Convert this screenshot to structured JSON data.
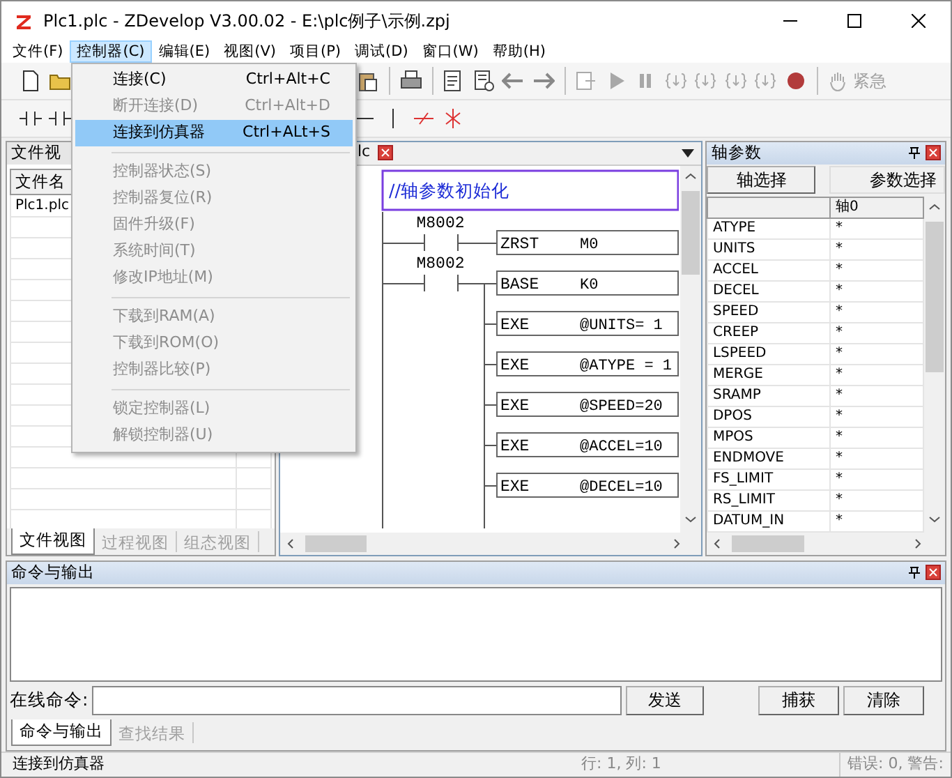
{
  "window": {
    "title": "Plc1.plc - ZDevelop V3.00.02 - E:\\plc例子\\示例.zpj"
  },
  "menu_bar": [
    {
      "label": "文件(F)",
      "selected": false
    },
    {
      "label": "控制器(C)",
      "selected": true
    },
    {
      "label": "编辑(E)",
      "selected": false
    },
    {
      "label": "视图(V)",
      "selected": false
    },
    {
      "label": "项目(P)",
      "selected": false
    },
    {
      "label": "调试(D)",
      "selected": false
    },
    {
      "label": "窗口(W)",
      "selected": false
    },
    {
      "label": "帮助(H)",
      "selected": false
    }
  ],
  "controller_menu": [
    {
      "kind": "item",
      "label": "连接(C)",
      "shortcut": "Ctrl+Alt+C",
      "disabled": false,
      "selected": false
    },
    {
      "kind": "item",
      "label": "断开连接(D)",
      "shortcut": "Ctrl+Alt+D",
      "disabled": true,
      "selected": false
    },
    {
      "kind": "item",
      "label": "连接到仿真器",
      "shortcut": "Ctrl+ALt+S",
      "disabled": false,
      "selected": true
    },
    {
      "kind": "separator"
    },
    {
      "kind": "item",
      "label": "控制器状态(S)",
      "disabled": true,
      "selected": false
    },
    {
      "kind": "item",
      "label": "控制器复位(R)",
      "disabled": true,
      "selected": false
    },
    {
      "kind": "item",
      "label": "固件升级(F)",
      "disabled": true,
      "selected": false
    },
    {
      "kind": "item",
      "label": "系统时间(T)",
      "disabled": true,
      "selected": false
    },
    {
      "kind": "item",
      "label": "修改IP地址(M)",
      "disabled": true,
      "selected": false
    },
    {
      "kind": "separator"
    },
    {
      "kind": "item",
      "label": "下载到RAM(A)",
      "disabled": true,
      "selected": false
    },
    {
      "kind": "item",
      "label": "下载到ROM(O)",
      "disabled": true,
      "selected": false
    },
    {
      "kind": "item",
      "label": "控制器比较(P)",
      "disabled": true,
      "selected": false
    },
    {
      "kind": "separator"
    },
    {
      "kind": "item",
      "label": "锁定控制器(L)",
      "disabled": true,
      "selected": false
    },
    {
      "kind": "item",
      "label": "解锁控制器(U)",
      "disabled": true,
      "selected": false
    }
  ],
  "toolbar": {
    "emergency_label": "紧急"
  },
  "file_panel": {
    "title": "文件视",
    "column": "文件名",
    "files": [
      "Plc1.plc"
    ],
    "tabs": [
      {
        "label": "文件视图",
        "selected": true
      },
      {
        "label": "过程视图",
        "selected": false
      },
      {
        "label": "组态视图",
        "selected": false
      }
    ]
  },
  "editor": {
    "tab": "lc",
    "comment": "//轴参数初始化",
    "rungs": [
      {
        "contact": "M8002",
        "instructions": [
          {
            "op": "ZRST",
            "arg": "M0"
          }
        ]
      },
      {
        "contact": "M8002",
        "instructions": [
          {
            "op": "BASE",
            "arg": "K0"
          },
          {
            "op": "EXE",
            "arg": "@UNITS= 1"
          },
          {
            "op": "EXE",
            "arg": "@ATYPE = 1"
          },
          {
            "op": "EXE",
            "arg": "@SPEED=20"
          },
          {
            "op": "EXE",
            "arg": "@ACCEL=10"
          },
          {
            "op": "EXE",
            "arg": "@DECEL=10"
          }
        ]
      }
    ]
  },
  "axis_panel": {
    "title": "轴参数",
    "buttons": [
      "轴选择",
      "参数选择"
    ],
    "column": "轴0",
    "rows": [
      {
        "name": "ATYPE",
        "value": "*"
      },
      {
        "name": "UNITS",
        "value": "*"
      },
      {
        "name": "ACCEL",
        "value": "*"
      },
      {
        "name": "DECEL",
        "value": "*"
      },
      {
        "name": "SPEED",
        "value": "*"
      },
      {
        "name": "CREEP",
        "value": "*"
      },
      {
        "name": "LSPEED",
        "value": "*"
      },
      {
        "name": "MERGE",
        "value": "*"
      },
      {
        "name": "SRAMP",
        "value": "*"
      },
      {
        "name": "DPOS",
        "value": "*"
      },
      {
        "name": "MPOS",
        "value": "*"
      },
      {
        "name": "ENDMOVE",
        "value": "*"
      },
      {
        "name": "FS_LIMIT",
        "value": "*"
      },
      {
        "name": "RS_LIMIT",
        "value": "*"
      },
      {
        "name": "DATUM_IN",
        "value": "*"
      }
    ]
  },
  "output_panel": {
    "title": "命令与输出",
    "command_label": "在线命令:",
    "buttons": [
      "发送",
      "捕获",
      "清除"
    ],
    "tabs": [
      {
        "label": "命令与输出",
        "selected": true
      },
      {
        "label": "查找结果",
        "selected": false
      }
    ]
  },
  "status_bar": {
    "message": "连接到仿真器",
    "position": "行: 1, 列: 1",
    "errors": "错误: 0, 警告:"
  }
}
